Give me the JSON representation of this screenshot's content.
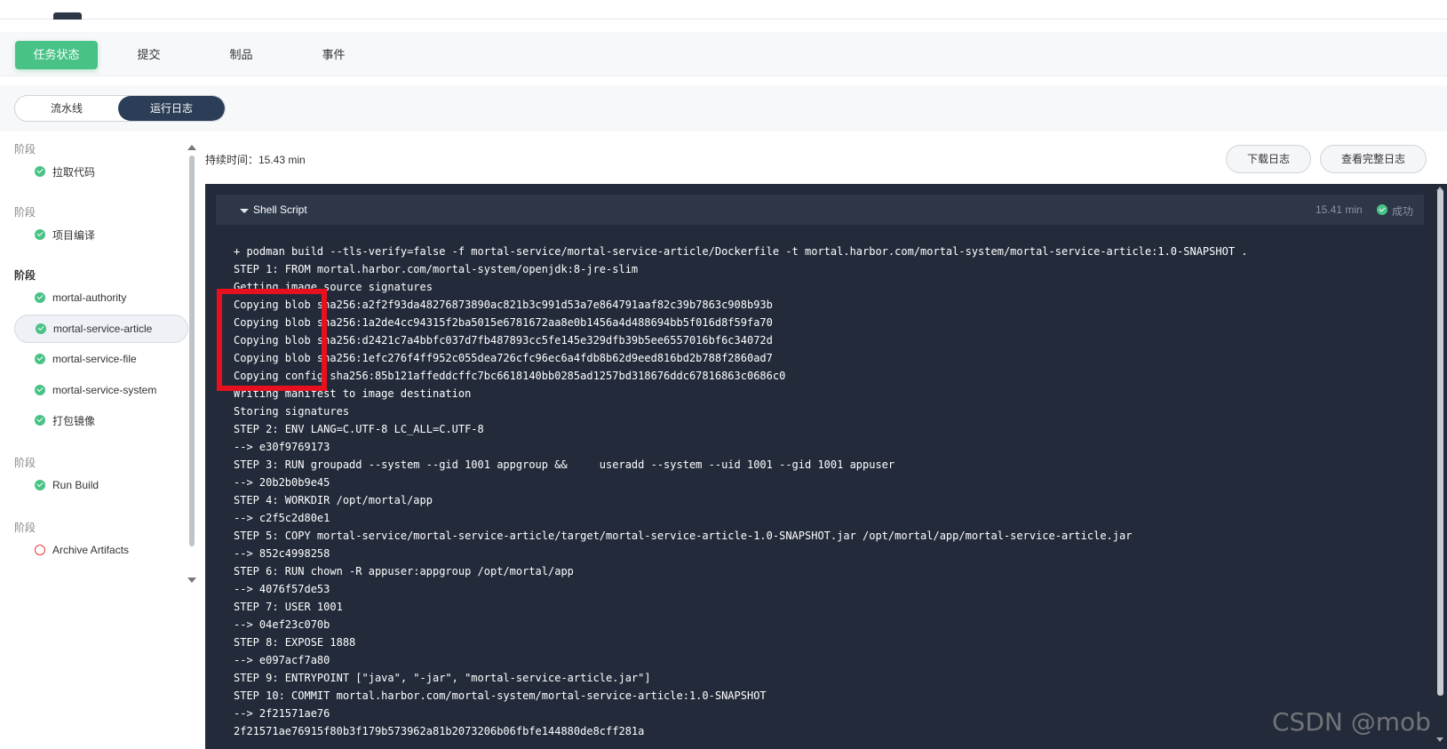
{
  "tabs": [
    "任务状态",
    "提交",
    "制品",
    "事件"
  ],
  "view_toggle": [
    "流水线",
    "运行日志"
  ],
  "sidebar": {
    "groups": [
      {
        "title": "阶段",
        "steps": [
          {
            "label": "拉取代码",
            "status": "success"
          }
        ]
      },
      {
        "title": "阶段",
        "steps": [
          {
            "label": "项目编译",
            "status": "success"
          }
        ]
      },
      {
        "title": "阶段",
        "steps": [
          {
            "label": "mortal-authority",
            "status": "success"
          },
          {
            "label": "mortal-service-article",
            "status": "success"
          },
          {
            "label": "mortal-service-file",
            "status": "success"
          },
          {
            "label": "mortal-service-system",
            "status": "success"
          },
          {
            "label": "打包镜像",
            "status": "success"
          }
        ]
      },
      {
        "title": "阶段",
        "steps": [
          {
            "label": "Run Build",
            "status": "success"
          }
        ]
      },
      {
        "title": "阶段",
        "steps": [
          {
            "label": "Archive Artifacts",
            "status": "pending"
          }
        ]
      }
    ]
  },
  "duration": "持续时间：15.43 min",
  "buttons": {
    "download": "下载日志",
    "full": "查看完整日志"
  },
  "console": {
    "title": "Shell Script",
    "time": "15.41 min",
    "status": "成功",
    "lines": [
      "+ podman build --tls-verify=false -f mortal-service/mortal-service-article/Dockerfile -t mortal.harbor.com/mortal-system/mortal-service-article:1.0-SNAPSHOT .",
      "STEP 1: FROM mortal.harbor.com/mortal-system/openjdk:8-jre-slim",
      "Getting image source signatures",
      "Copying blob sha256:a2f2f93da48276873890ac821b3c991d53a7e864791aaf82c39b7863c908b93b",
      "Copying blob sha256:1a2de4cc94315f2ba5015e6781672aa8e0b1456a4d488694bb5f016d8f59fa70",
      "Copying blob sha256:d2421c7a4bbfc037d7fb487893cc5fe145e329dfb39b5ee6557016bf6c34072d",
      "Copying blob sha256:1efc276f4ff952c055dea726cfc96ec6a4fdb8b62d9eed816bd2b788f2860ad7",
      "Copying config sha256:85b121affeddcffc7bc6618140bb0285ad1257bd318676ddc67816863c0686c0",
      "Writing manifest to image destination",
      "Storing signatures",
      "STEP 2: ENV LANG=C.UTF-8 LC_ALL=C.UTF-8",
      "--> e30f9769173",
      "STEP 3: RUN groupadd --system --gid 1001 appgroup &&     useradd --system --uid 1001 --gid 1001 appuser",
      "--> 20b2b0b9e45",
      "STEP 4: WORKDIR /opt/mortal/app",
      "--> c2f5c2d80e1",
      "STEP 5: COPY mortal-service/mortal-service-article/target/mortal-service-article-1.0-SNAPSHOT.jar /opt/mortal/app/mortal-service-article.jar",
      "--> 852c4998258",
      "STEP 6: RUN chown -R appuser:appgroup /opt/mortal/app",
      "--> 4076f57de53",
      "STEP 7: USER 1001",
      "--> 04ef23c070b",
      "STEP 8: EXPOSE 1888",
      "--> e097acf7a80",
      "STEP 9: ENTRYPOINT [\"java\", \"-jar\", \"mortal-service-article.jar\"]",
      "STEP 10: COMMIT mortal.harbor.com/mortal-system/mortal-service-article:1.0-SNAPSHOT",
      "--> 2f21571ae76",
      "2f21571ae76915f80b3f179b573962a81b2073206b06fbfe144880de8cff281a"
    ]
  },
  "watermark": "CSDN @mob"
}
